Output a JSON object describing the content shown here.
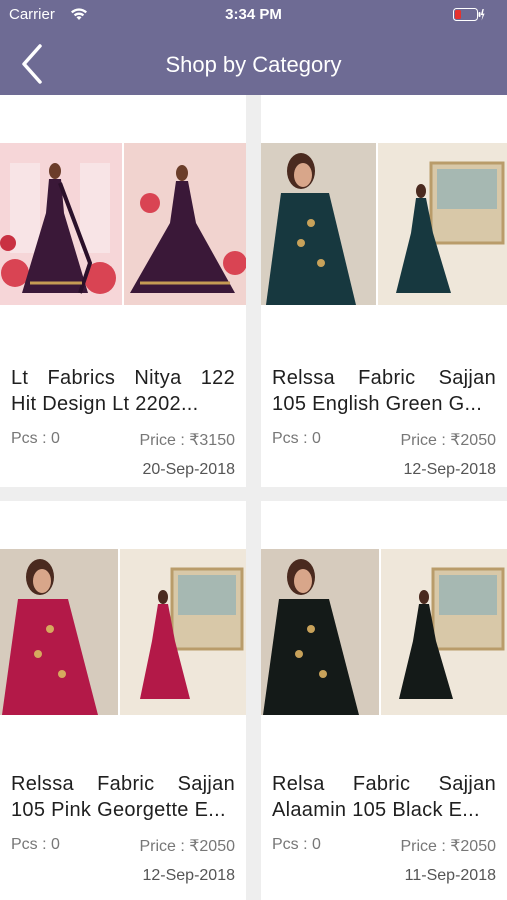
{
  "status_bar": {
    "carrier": "Carrier",
    "time": "3:34 PM",
    "battery_color": "#e5322d"
  },
  "header": {
    "title": "Shop by Category",
    "background": "#6e6b94"
  },
  "products": [
    {
      "title_line1": "Lt Fabrics Nitya 122",
      "title_line2": "Hit Design Lt 2202...",
      "pcs": "Pcs : 0",
      "price": "Price : ₹3150",
      "date": "20-Sep-2018",
      "image_icon": "dress-photo-icon",
      "dress_color": "#3a1838"
    },
    {
      "title_line1": "Relssa Fabric Sajjan",
      "title_line2": "105 English Green G...",
      "pcs": "Pcs : 0",
      "price": "Price : ₹2050",
      "date": "12-Sep-2018",
      "image_icon": "dress-photo-icon",
      "dress_color": "#17383f"
    },
    {
      "title_line1": "Relssa Fabric Sajjan",
      "title_line2": "105 Pink Georgette E...",
      "pcs": "Pcs : 0",
      "price": "Price : ₹2050",
      "date": "12-Sep-2018",
      "image_icon": "dress-photo-icon",
      "dress_color": "#b31948"
    },
    {
      "title_line1": "Relsa Fabric Sajjan",
      "title_line2": "Alaamin 105 Black E...",
      "pcs": "Pcs : 0",
      "price": "Price : ₹2050",
      "date": "11-Sep-2018",
      "image_icon": "dress-photo-icon",
      "dress_color": "#141a18"
    }
  ]
}
